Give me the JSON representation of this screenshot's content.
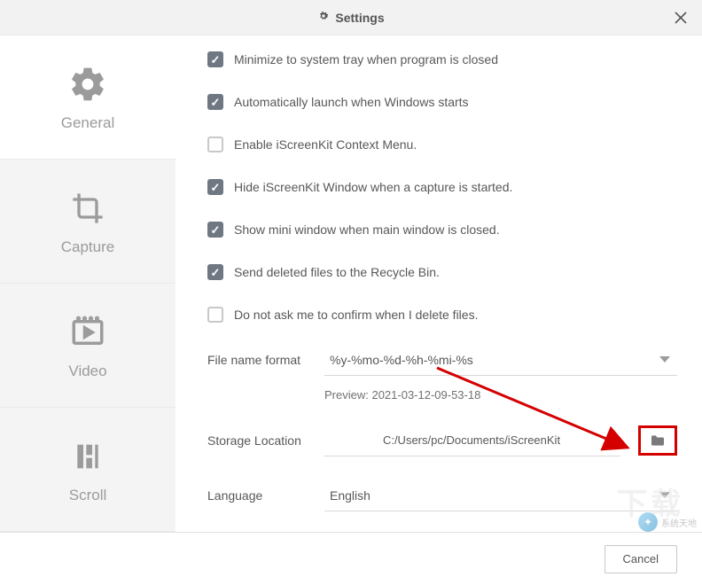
{
  "header": {
    "title": "Settings"
  },
  "sidebar": {
    "items": [
      {
        "label": "General"
      },
      {
        "label": "Capture"
      },
      {
        "label": "Video"
      },
      {
        "label": "Scroll"
      }
    ]
  },
  "options": {
    "minimize_tray": {
      "label": "Minimize to system tray when program is closed",
      "checked": true
    },
    "auto_launch": {
      "label": "Automatically launch when Windows starts",
      "checked": true
    },
    "context_menu": {
      "label": "Enable iScreenKit Context Menu.",
      "checked": false
    },
    "hide_window": {
      "label": "Hide iScreenKit Window when a capture is started.",
      "checked": true
    },
    "mini_window": {
      "label": "Show mini window when main window is closed.",
      "checked": true
    },
    "recycle_bin": {
      "label": "Send deleted files to the Recycle Bin.",
      "checked": true
    },
    "confirm_delete": {
      "label": "Do not ask me to confirm when I delete files.",
      "checked": false
    }
  },
  "format": {
    "label": "File name format",
    "value": "%y-%mo-%d-%h-%mi-%s",
    "preview": "Preview: 2021-03-12-09-53-18"
  },
  "storage": {
    "label": "Storage Location",
    "value": "C:/Users/pc/Documents/iScreenKit"
  },
  "language": {
    "label": "Language",
    "value": "English"
  },
  "footer": {
    "cancel": "Cancel"
  },
  "watermark": {
    "text": "系统天地"
  }
}
